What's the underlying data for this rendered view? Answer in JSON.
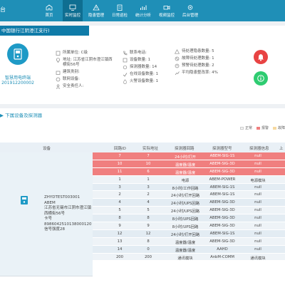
{
  "brand": "台",
  "nav": [
    {
      "label": "首页",
      "icon": "home-icon",
      "active": false
    },
    {
      "label": "实时监控",
      "icon": "monitor-icon",
      "active": true
    },
    {
      "label": "隐患管理",
      "icon": "warning-icon",
      "active": false
    },
    {
      "label": "日常巡检",
      "icon": "clipboard-icon",
      "active": false
    },
    {
      "label": "统计分析",
      "icon": "chart-icon",
      "active": false
    },
    {
      "label": "视频监控",
      "icon": "video-icon",
      "active": false
    },
    {
      "label": "后台管理",
      "icon": "settings-icon",
      "active": false
    }
  ],
  "device": {
    "title": "中国银行江阴澄江支行)",
    "code_line1": "智慧用电终端",
    "code_line2": "201912200002",
    "info_col1": [
      "所属单位: C级",
      "地址: 江苏省江阴市澄江镇西横街56号",
      "建筑类别:",
      "联网设备:",
      "安全责任人:"
    ],
    "info_col2": [
      "联系电话:",
      "设备数量: 1",
      "探测器数量: 14",
      "在线设备数量: 1",
      "火警设备数量: 1"
    ],
    "info_col3": [
      "待处理隐患数量: 5",
      "故障待处理数量: 1",
      "预警待处理数量: 2",
      "平均隐患整改率: 4%"
    ]
  },
  "lower": {
    "title": "下属设备及探测器",
    "legend": [
      {
        "label": "正常",
        "color": "#f5f5f5"
      },
      {
        "label": "报警",
        "color": "#f07f7f"
      },
      {
        "label": "故障",
        "color": "#f6d9a0"
      }
    ],
    "headers": [
      "设备",
      "回路ID",
      "实际地址",
      "探测器回路",
      "探测器型号",
      "探测器信息",
      "上"
    ],
    "device_cell": [
      "ZHYDTEST003001",
      "ABEM",
      "江苏省无锡市江阴市澄江镇西横街56号",
      "卡号8986042510138000120",
      "信号强度28"
    ],
    "rows": [
      {
        "id": "7",
        "addr": "7",
        "loop": "24小时/打开",
        "model": "ABEM-SIG-1S",
        "info": "null",
        "status": "alarm"
      },
      {
        "id": "10",
        "addr": "10",
        "loop": "温度器/温度",
        "model": "ABEM-SIG-3D",
        "info": "null",
        "status": "alarm"
      },
      {
        "id": "11",
        "addr": "6",
        "loop": "温度器/温度",
        "model": "ABEM-SIG-3D",
        "info": "null",
        "status": "alarm"
      },
      {
        "id": "1",
        "addr": "1",
        "loop": "电源",
        "model": "ABEM-POWER",
        "info": "电源模块",
        "status": "normal"
      },
      {
        "id": "3",
        "addr": "3",
        "loop": "8小时/工作回路",
        "model": "ABEM-SIG-1S",
        "info": "null",
        "status": "normal"
      },
      {
        "id": "2",
        "addr": "2",
        "loop": "24小时/打开回路",
        "model": "ABEM-SIG-1S",
        "info": "null",
        "status": "normal"
      },
      {
        "id": "4",
        "addr": "4",
        "loop": "24小时/UPS回路",
        "model": "ABEM-SIG-3D",
        "info": "null",
        "status": "normal"
      },
      {
        "id": "5",
        "addr": "5",
        "loop": "24小时/UPS回路",
        "model": "ABEM-SIG-3D",
        "info": "null",
        "status": "normal"
      },
      {
        "id": "8",
        "addr": "8",
        "loop": "8小时/UPS回路",
        "model": "ABEM-SIG-3D",
        "info": "null",
        "status": "normal"
      },
      {
        "id": "9",
        "addr": "9",
        "loop": "8小时/UPS回路",
        "model": "ABEM-SIG-3D",
        "info": "null",
        "status": "normal"
      },
      {
        "id": "12",
        "addr": "12",
        "loop": "24小时/打开回路",
        "model": "ABEM-SIG-1S",
        "info": "null",
        "status": "normal"
      },
      {
        "id": "13",
        "addr": "8",
        "loop": "温度器/温度",
        "model": "ABEM-SIG-3D",
        "info": "null",
        "status": "normal"
      },
      {
        "id": "14",
        "addr": "0",
        "loop": "温度器/温度",
        "model": "AAHD",
        "info": "null",
        "status": "normal"
      },
      {
        "id": "200",
        "addr": "200",
        "loop": "通讯模块",
        "model": "AnbM-COMM",
        "info": "通讯模块",
        "status": "normal"
      }
    ]
  },
  "colors": {
    "nav": "#1f8fb7",
    "nav_active": "#0f6e91",
    "alarm": "#f07f7f",
    "normal": "#e7eef4",
    "bell": "#e84343",
    "status_ok": "#2ecc71",
    "info": "#1f8fb7"
  }
}
